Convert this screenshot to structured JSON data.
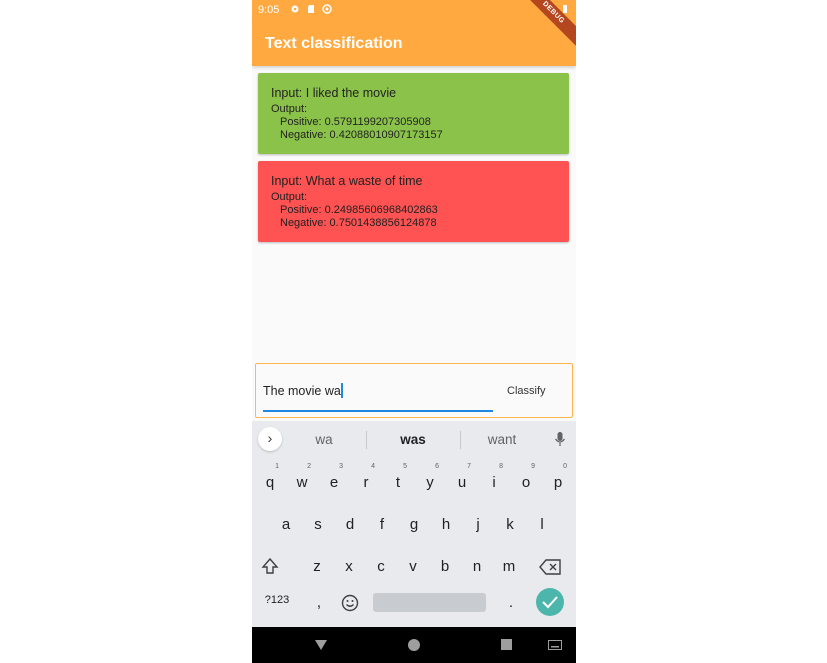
{
  "status": {
    "time": "9:05"
  },
  "appbar": {
    "title": "Text classification",
    "debug_label": "DEBUG",
    "color": "#ffa940"
  },
  "results": [
    {
      "input": "Input: I liked the movie",
      "output_label": "Output:",
      "positive": "Positive: 0.5791199207305908",
      "negative": "Negative: 0.42088010907173157",
      "color": "#8bc34a"
    },
    {
      "input": "Input: What a waste of time",
      "output_label": "Output:",
      "positive": "Positive: 0.24985606968402863",
      "negative": "Negative: 0.7501438856124878",
      "color": "#ff5252"
    }
  ],
  "input": {
    "value": "The movie wa",
    "classify_label": "Classify"
  },
  "keyboard": {
    "suggestions": [
      "wa",
      "was",
      "want"
    ],
    "row1": [
      {
        "k": "q",
        "n": "1"
      },
      {
        "k": "w",
        "n": "2"
      },
      {
        "k": "e",
        "n": "3"
      },
      {
        "k": "r",
        "n": "4"
      },
      {
        "k": "t",
        "n": "5"
      },
      {
        "k": "y",
        "n": "6"
      },
      {
        "k": "u",
        "n": "7"
      },
      {
        "k": "i",
        "n": "8"
      },
      {
        "k": "o",
        "n": "9"
      },
      {
        "k": "p",
        "n": "0"
      }
    ],
    "row2": [
      "a",
      "s",
      "d",
      "f",
      "g",
      "h",
      "j",
      "k",
      "l"
    ],
    "row3": [
      "z",
      "x",
      "c",
      "v",
      "b",
      "n",
      "m"
    ],
    "symbols_label": "?123",
    "comma": ",",
    "period": "."
  }
}
